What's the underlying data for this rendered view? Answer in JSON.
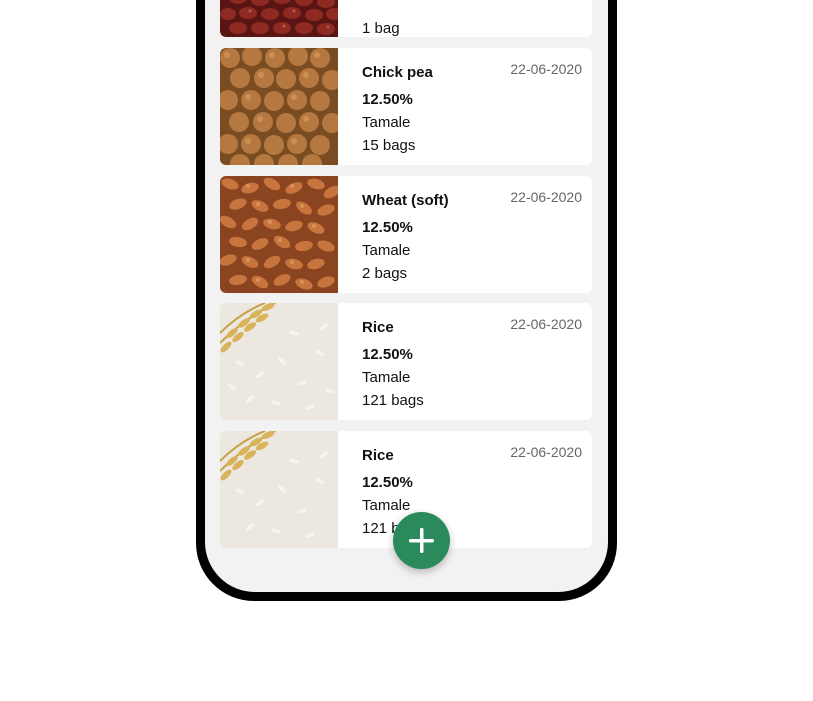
{
  "items": [
    {
      "title": "",
      "date": "",
      "percentage": "",
      "location": "",
      "quantity": "1 bag",
      "image": "red-beans"
    },
    {
      "title": "Chick pea",
      "date": "22-06-2020",
      "percentage": "12.50%",
      "location": "Tamale",
      "quantity": "15 bags",
      "image": "chickpeas"
    },
    {
      "title": "Wheat (soft)",
      "date": "22-06-2020",
      "percentage": "12.50%",
      "location": "Tamale",
      "quantity": "2 bags",
      "image": "wheat"
    },
    {
      "title": "Rice",
      "date": "22-06-2020",
      "percentage": "12.50%",
      "location": "Tamale",
      "quantity": "121 bags",
      "image": "rice"
    },
    {
      "title": "Rice",
      "date": "22-06-2020",
      "percentage": "12.50%",
      "location": "Tamale",
      "quantity": "121 bags",
      "image": "rice"
    }
  ],
  "fab": {
    "icon": "plus-icon",
    "color": "#2a8a5b"
  }
}
